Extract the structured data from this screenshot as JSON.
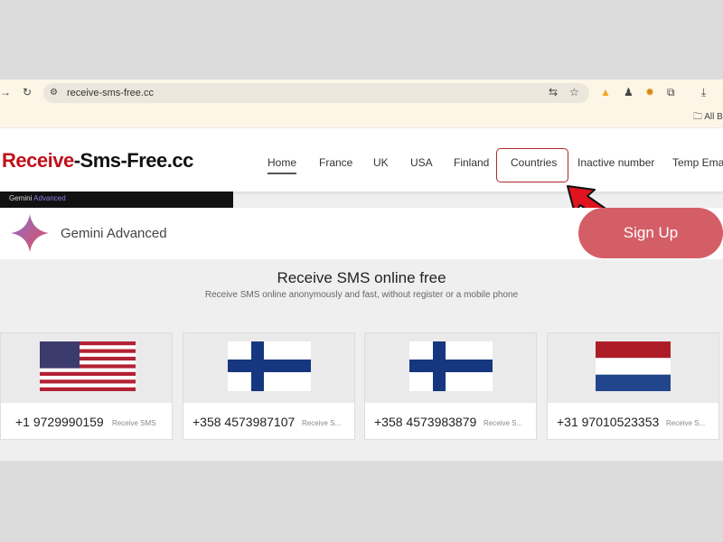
{
  "browser": {
    "url": "receive-sms-free.cc",
    "bookmarks_label": "All B"
  },
  "site": {
    "logo_red": "Receive",
    "logo_black": "-Sms-Free.cc",
    "nav": [
      "Home",
      "France",
      "UK",
      "USA",
      "Finland",
      "Countries",
      "Inactive number",
      "Temp Email"
    ]
  },
  "ad": {
    "bar_label": "Gemini",
    "bar_label_accent": "Advanced",
    "title": "Gemini Advanced",
    "cta": "Sign Up"
  },
  "main": {
    "title": "Receive SMS online free",
    "subtitle": "Receive SMS online anonymously and fast, without register or a mobile phone"
  },
  "numbers": [
    {
      "country": "USA",
      "number": "+1 9729990159",
      "label": "Receive SMS"
    },
    {
      "country": "Finland",
      "number": "+358 4573987107",
      "label": "Receive S..."
    },
    {
      "country": "Finland",
      "number": "+358 4573983879",
      "label": "Receive S..."
    },
    {
      "country": "Netherlands",
      "number": "+31 97010523353",
      "label": "Receive S..."
    }
  ],
  "colors": {
    "brand": "#c0121b",
    "cta": "#d45e66",
    "highlight": "#b0262a",
    "arrow": "#e0141e"
  }
}
